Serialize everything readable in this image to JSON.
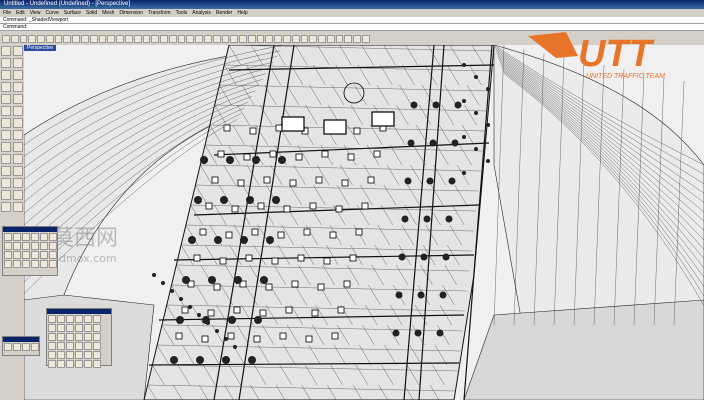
{
  "window": {
    "title": "Untitled - Undefined (Undefined) - [Perspective]"
  },
  "menu": [
    "File",
    "Edit",
    "View",
    "Curve",
    "Surface",
    "Solid",
    "Mesh",
    "Dimension",
    "Transform",
    "Tools",
    "Analysis",
    "Render",
    "Help"
  ],
  "command": {
    "history": "Command: _ShadedViewport",
    "prompt": "Command:"
  },
  "viewport": {
    "label": "Perspective"
  },
  "logo": {
    "text": "UTT",
    "subtitle": "UNITED TRAFFIC TEAM",
    "color": "#e8742a"
  },
  "watermark": {
    "cn": "莫西网",
    "url": "3dmox.com"
  },
  "icons": {
    "toolbar_count": 42,
    "left_count": 28
  },
  "colors": {
    "mesh_line": "#1a1a1a",
    "surface": "#e6e6e6",
    "viewport_tab": "#2b4a9a"
  }
}
